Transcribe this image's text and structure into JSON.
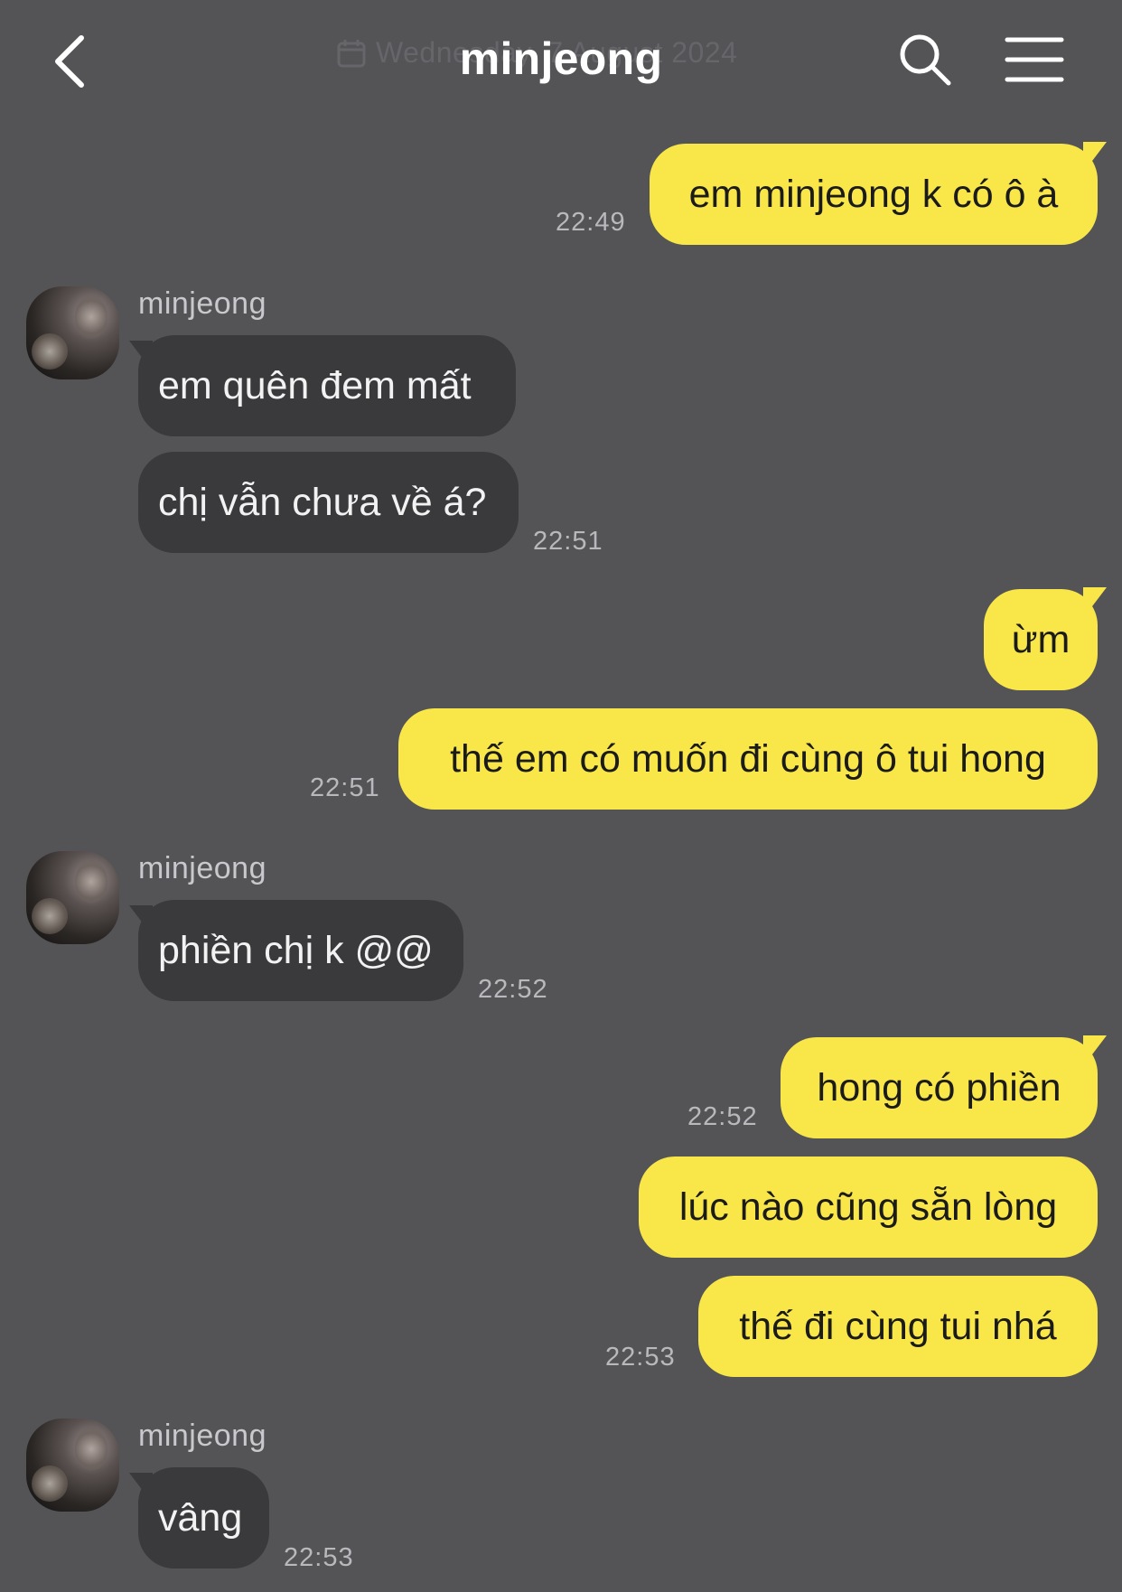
{
  "header": {
    "title": "minjeong",
    "date_text": "Wednesday, 7 August 2024",
    "back_icon": "chevron-left-icon",
    "search_icon": "search-icon",
    "menu_icon": "hamburger-menu-icon",
    "calendar_icon": "calendar-icon"
  },
  "colors": {
    "background": "#545356",
    "my_bubble": "#f9e74a",
    "their_bubble": "#3a393c",
    "timestamp": "#b9b8bc"
  },
  "messages": [
    {
      "from": "me",
      "text": "em minjeong k có ô à",
      "time": "22:49"
    },
    {
      "from": "minjeong",
      "sender": "minjeong",
      "text": "em quên đem mất"
    },
    {
      "from": "minjeong",
      "text": "chị vẫn chưa về á?",
      "time": "22:51"
    },
    {
      "from": "me",
      "text": "ừm"
    },
    {
      "from": "me",
      "text": "thế em có muốn đi cùng ô tui hong",
      "time": "22:51"
    },
    {
      "from": "minjeong",
      "sender": "minjeong",
      "text": "phiền chị k @@",
      "time": "22:52"
    },
    {
      "from": "me",
      "text": "hong có phiền",
      "time": "22:52"
    },
    {
      "from": "me",
      "text": "lúc nào cũng sẵn lòng"
    },
    {
      "from": "me",
      "text": "thế đi cùng tui nhá",
      "time": "22:53"
    },
    {
      "from": "minjeong",
      "sender": "minjeong",
      "text": "vâng",
      "time": "22:53"
    }
  ]
}
